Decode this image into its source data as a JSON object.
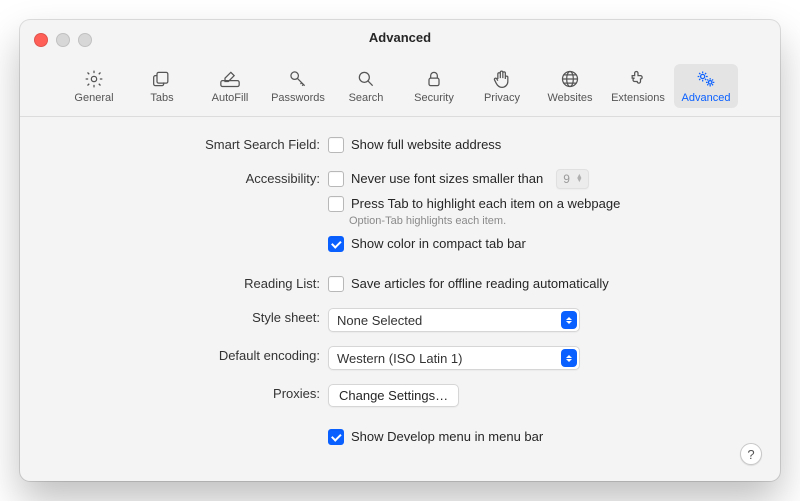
{
  "window": {
    "title": "Advanced"
  },
  "toolbar": [
    {
      "id": "general",
      "label": "General"
    },
    {
      "id": "tabs",
      "label": "Tabs"
    },
    {
      "id": "autofill",
      "label": "AutoFill"
    },
    {
      "id": "passwords",
      "label": "Passwords"
    },
    {
      "id": "search",
      "label": "Search"
    },
    {
      "id": "security",
      "label": "Security"
    },
    {
      "id": "privacy",
      "label": "Privacy"
    },
    {
      "id": "websites",
      "label": "Websites"
    },
    {
      "id": "extensions",
      "label": "Extensions"
    },
    {
      "id": "advanced",
      "label": "Advanced",
      "selected": true
    }
  ],
  "sections": {
    "smartSearch": {
      "label": "Smart Search Field:",
      "showFullAddress": {
        "text": "Show full website address",
        "checked": false
      }
    },
    "accessibility": {
      "label": "Accessibility:",
      "neverSmaller": {
        "text": "Never use font sizes smaller than",
        "checked": false,
        "value": "9"
      },
      "pressTab": {
        "text": "Press Tab to highlight each item on a webpage",
        "checked": false,
        "hint": "Option-Tab highlights each item."
      },
      "compactColor": {
        "text": "Show color in compact tab bar",
        "checked": true
      }
    },
    "readingList": {
      "label": "Reading List:",
      "saveOffline": {
        "text": "Save articles for offline reading automatically",
        "checked": false
      }
    },
    "styleSheet": {
      "label": "Style sheet:",
      "value": "None Selected"
    },
    "defaultEncoding": {
      "label": "Default encoding:",
      "value": "Western (ISO Latin 1)"
    },
    "proxies": {
      "label": "Proxies:",
      "button": "Change Settings…"
    },
    "developMenu": {
      "text": "Show Develop menu in menu bar",
      "checked": true
    }
  },
  "help": "?"
}
